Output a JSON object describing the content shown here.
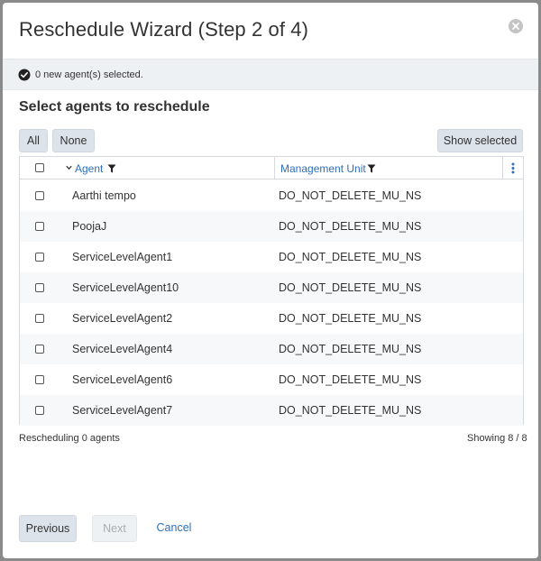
{
  "dialog": {
    "title": "Reschedule Wizard (Step 2 of 4)",
    "notice": "0 new agent(s) selected.",
    "section_title": "Select agents to reschedule"
  },
  "toolbar": {
    "all_label": "All",
    "none_label": "None",
    "show_selected_label": "Show selected"
  },
  "grid": {
    "columns": [
      "Agent",
      "Management Unit"
    ],
    "rows": [
      {
        "agent": "Aarthi tempo",
        "mu": "DO_NOT_DELETE_MU_NS"
      },
      {
        "agent": "PoojaJ",
        "mu": "DO_NOT_DELETE_MU_NS"
      },
      {
        "agent": "ServiceLevelAgent1",
        "mu": "DO_NOT_DELETE_MU_NS"
      },
      {
        "agent": "ServiceLevelAgent10",
        "mu": "DO_NOT_DELETE_MU_NS"
      },
      {
        "agent": "ServiceLevelAgent2",
        "mu": "DO_NOT_DELETE_MU_NS"
      },
      {
        "agent": "ServiceLevelAgent4",
        "mu": "DO_NOT_DELETE_MU_NS"
      },
      {
        "agent": "ServiceLevelAgent6",
        "mu": "DO_NOT_DELETE_MU_NS"
      },
      {
        "agent": "ServiceLevelAgent7",
        "mu": "DO_NOT_DELETE_MU_NS"
      }
    ]
  },
  "status": {
    "rescheduling": "Rescheduling 0 agents",
    "showing": "Showing 8 / 8"
  },
  "footer": {
    "previous_label": "Previous",
    "next_label": "Next",
    "cancel_label": "Cancel"
  },
  "icons": {
    "close": "close-circle-icon",
    "notice": "check-circle-icon",
    "sort": "chevron-down-icon",
    "filter": "filter-icon",
    "menu": "kebab-menu-icon"
  },
  "colors": {
    "accent": "#2f6fb8",
    "button_bg": "#dde3ea",
    "notice_bg": "#eef1f4"
  }
}
